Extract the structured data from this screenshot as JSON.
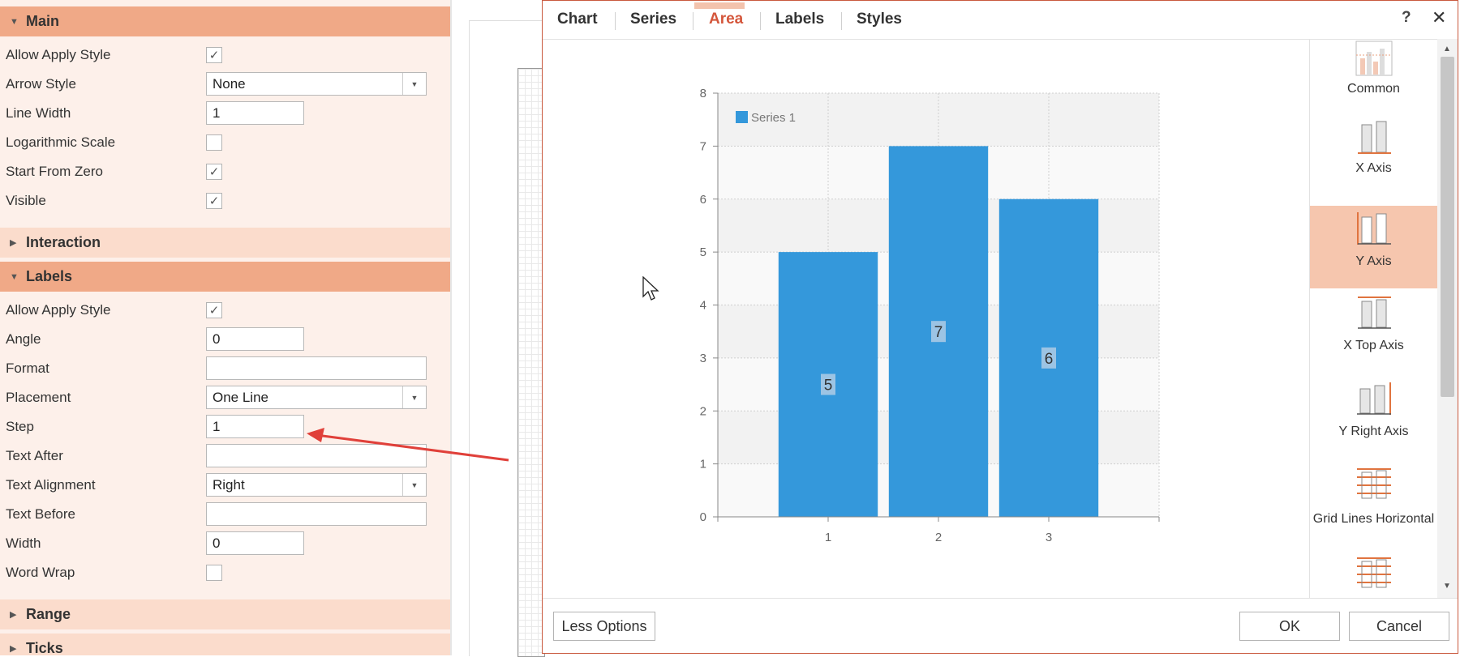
{
  "left_panel": {
    "sections": {
      "main": "Main",
      "interaction": "Interaction",
      "labels": "Labels",
      "range": "Range",
      "ticks": "Ticks"
    },
    "main_props": {
      "allow_apply_style": {
        "label": "Allow Apply Style",
        "checked": true
      },
      "arrow_style": {
        "label": "Arrow Style",
        "value": "None"
      },
      "line_width": {
        "label": "Line Width",
        "value": "1"
      },
      "logarithmic_scale": {
        "label": "Logarithmic Scale",
        "checked": false
      },
      "start_from_zero": {
        "label": "Start From Zero",
        "checked": true
      },
      "visible": {
        "label": "Visible",
        "checked": true
      }
    },
    "labels_props": {
      "allow_apply_style": {
        "label": "Allow Apply Style",
        "checked": true
      },
      "angle": {
        "label": "Angle",
        "value": "0"
      },
      "format": {
        "label": "Format",
        "value": ""
      },
      "placement": {
        "label": "Placement",
        "value": "One Line"
      },
      "step": {
        "label": "Step",
        "value": "1"
      },
      "text_after": {
        "label": "Text After",
        "value": ""
      },
      "text_alignment": {
        "label": "Text Alignment",
        "value": "Right"
      },
      "text_before": {
        "label": "Text Before",
        "value": ""
      },
      "width": {
        "label": "Width",
        "value": "0"
      },
      "word_wrap": {
        "label": "Word Wrap",
        "checked": false
      }
    }
  },
  "dialog": {
    "tabs": [
      "Chart",
      "Series",
      "Area",
      "Labels",
      "Styles"
    ],
    "active_tab": "Area",
    "help": "?",
    "close": "✕",
    "side_items": [
      "Common",
      "X Axis",
      "Y Axis",
      "X Top Axis",
      "Y Right Axis",
      "Grid Lines Horizontal"
    ],
    "selected_side_item": "Y Axis",
    "footer": {
      "less_options": "Less Options",
      "ok": "OK",
      "cancel": "Cancel"
    },
    "accent_color": "#d4563b",
    "selected_bg": "#f6c6ae"
  },
  "chart_data": {
    "type": "bar",
    "categories": [
      "1",
      "2",
      "3"
    ],
    "series": [
      {
        "name": "Series 1",
        "values": [
          5,
          7,
          6
        ],
        "color": "#3498db"
      }
    ],
    "data_labels": [
      "5",
      "7",
      "6"
    ],
    "ylim": [
      0,
      8
    ],
    "yticks": [
      "0",
      "1",
      "2",
      "3",
      "4",
      "5",
      "6",
      "7",
      "8"
    ],
    "grid": true,
    "legend": "top-left"
  }
}
